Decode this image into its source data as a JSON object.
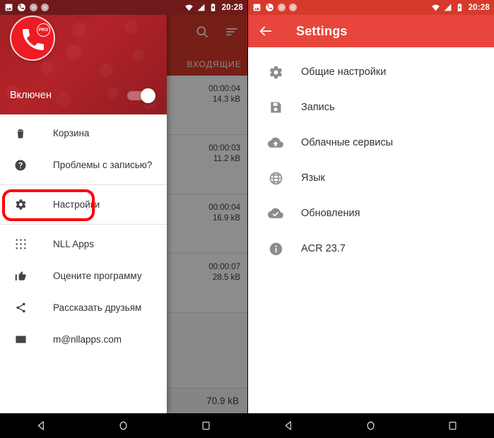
{
  "left_phone": {
    "statusbar": {
      "time": "20:28",
      "left_icons": [
        "image-icon",
        "phone-call-icon",
        "circle-record-icon",
        "circle-record-icon"
      ],
      "right_icons": [
        "wifi-icon",
        "signal-icon",
        "battery-charging-icon"
      ]
    },
    "drawer": {
      "logo": {
        "icon": "phone-handset-icon",
        "badge": "PRO"
      },
      "enabled_label": "Включен",
      "toggle_state": "on",
      "items": [
        {
          "label": "Корзина",
          "icon": "trash-icon"
        },
        {
          "label": "Проблемы с записью?",
          "icon": "help-circle-icon"
        },
        {
          "label": "Настройки",
          "icon": "gear-icon",
          "highlighted": true
        },
        {
          "label": "NLL Apps",
          "icon": "apps-grid-icon"
        },
        {
          "label": "Оцените программу",
          "icon": "thumbs-up-icon"
        },
        {
          "label": "Рассказать друзьям",
          "icon": "share-icon"
        },
        {
          "label": "m@nllapps.com",
          "icon": "mail-icon"
        }
      ]
    },
    "call_list": {
      "toolbar_icons": [
        "search-icon",
        "sort-icon"
      ],
      "tab_label": "ВХОДЯЩИЕ",
      "rows": [
        {
          "duration": "00:00:04",
          "size": "14.3 kB"
        },
        {
          "duration": "00:00:03",
          "size": "11.2 kB"
        },
        {
          "duration": "00:00:04",
          "size": "16.9 kB"
        },
        {
          "duration": "00:00:07",
          "size": "28.5 kB"
        }
      ],
      "total_size": "70.9 kB"
    }
  },
  "right_phone": {
    "statusbar": {
      "time": "20:28",
      "left_icons": [
        "image-icon",
        "phone-call-icon",
        "circle-record-icon",
        "circle-record-icon"
      ],
      "right_icons": [
        "wifi-icon",
        "signal-icon",
        "battery-charging-icon"
      ]
    },
    "toolbar": {
      "back_icon": "arrow-back-icon",
      "title": "Settings"
    },
    "items": [
      {
        "label": "Общие настройки",
        "icon": "gear-icon"
      },
      {
        "label": "Запись",
        "icon": "save-floppy-icon"
      },
      {
        "label": "Облачные сервисы",
        "icon": "cloud-upload-icon"
      },
      {
        "label": "Язык",
        "icon": "globe-icon"
      },
      {
        "label": "Обновления",
        "icon": "cloud-done-icon"
      },
      {
        "label": "ACR 23.7",
        "icon": "info-icon"
      }
    ]
  },
  "navbar": {
    "buttons": [
      {
        "name": "back-button",
        "icon": "triangle-back-icon"
      },
      {
        "name": "home-button",
        "icon": "circle-home-icon"
      },
      {
        "name": "recents-button",
        "icon": "square-recents-icon"
      }
    ]
  },
  "colors": {
    "drawer_header_red": "#a31f22",
    "toolbar_red": "#e8453c",
    "status_dark_red": "#6e1a1a",
    "highlight_red": "#ff0000",
    "logo_red": "#ed1c24"
  }
}
